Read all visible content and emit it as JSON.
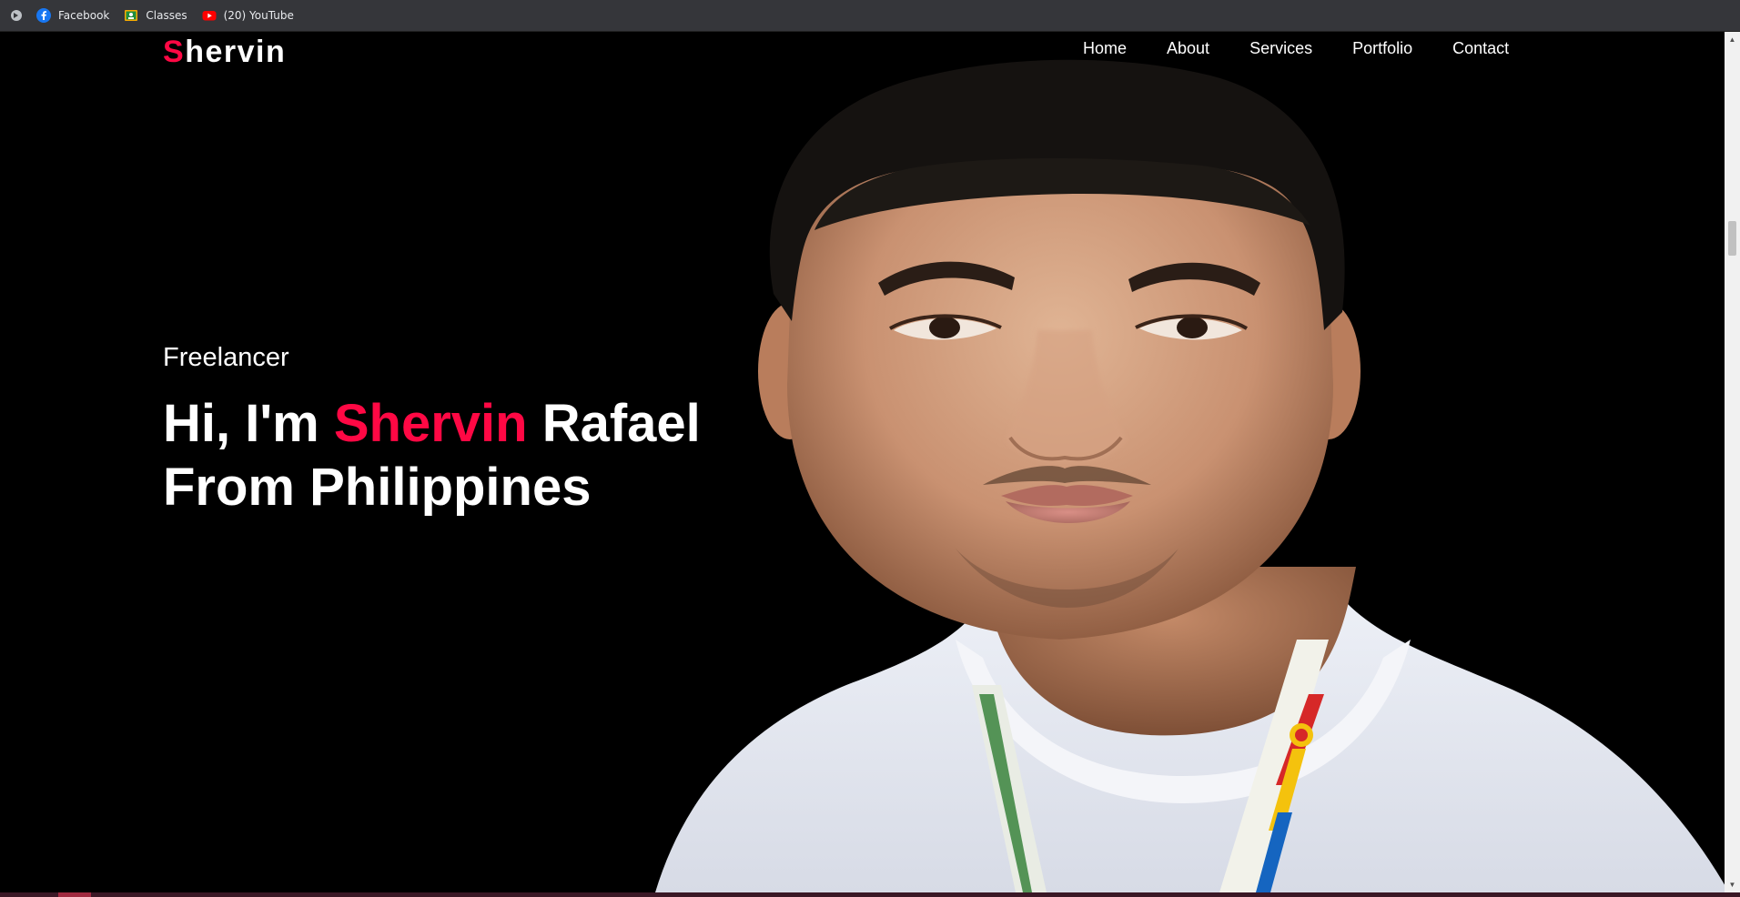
{
  "bookmarks": [
    {
      "label": "Facebook",
      "icon": "facebook-icon"
    },
    {
      "label": "Classes",
      "icon": "classes-icon"
    },
    {
      "label": "(20) YouTube",
      "icon": "youtube-icon"
    }
  ],
  "logo": {
    "first_letter": "S",
    "rest": "hervin"
  },
  "nav": [
    "Home",
    "About",
    "Services",
    "Portfolio",
    "Contact"
  ],
  "hero": {
    "subtitle": "Freelancer",
    "line1_prefix": "Hi, I'm ",
    "line1_name": "Shervin",
    "line1_suffix": " Rafael",
    "line2": "From Philippines"
  },
  "colors": {
    "accent": "#ff0844",
    "background": "#000000",
    "text": "#ffffff"
  }
}
